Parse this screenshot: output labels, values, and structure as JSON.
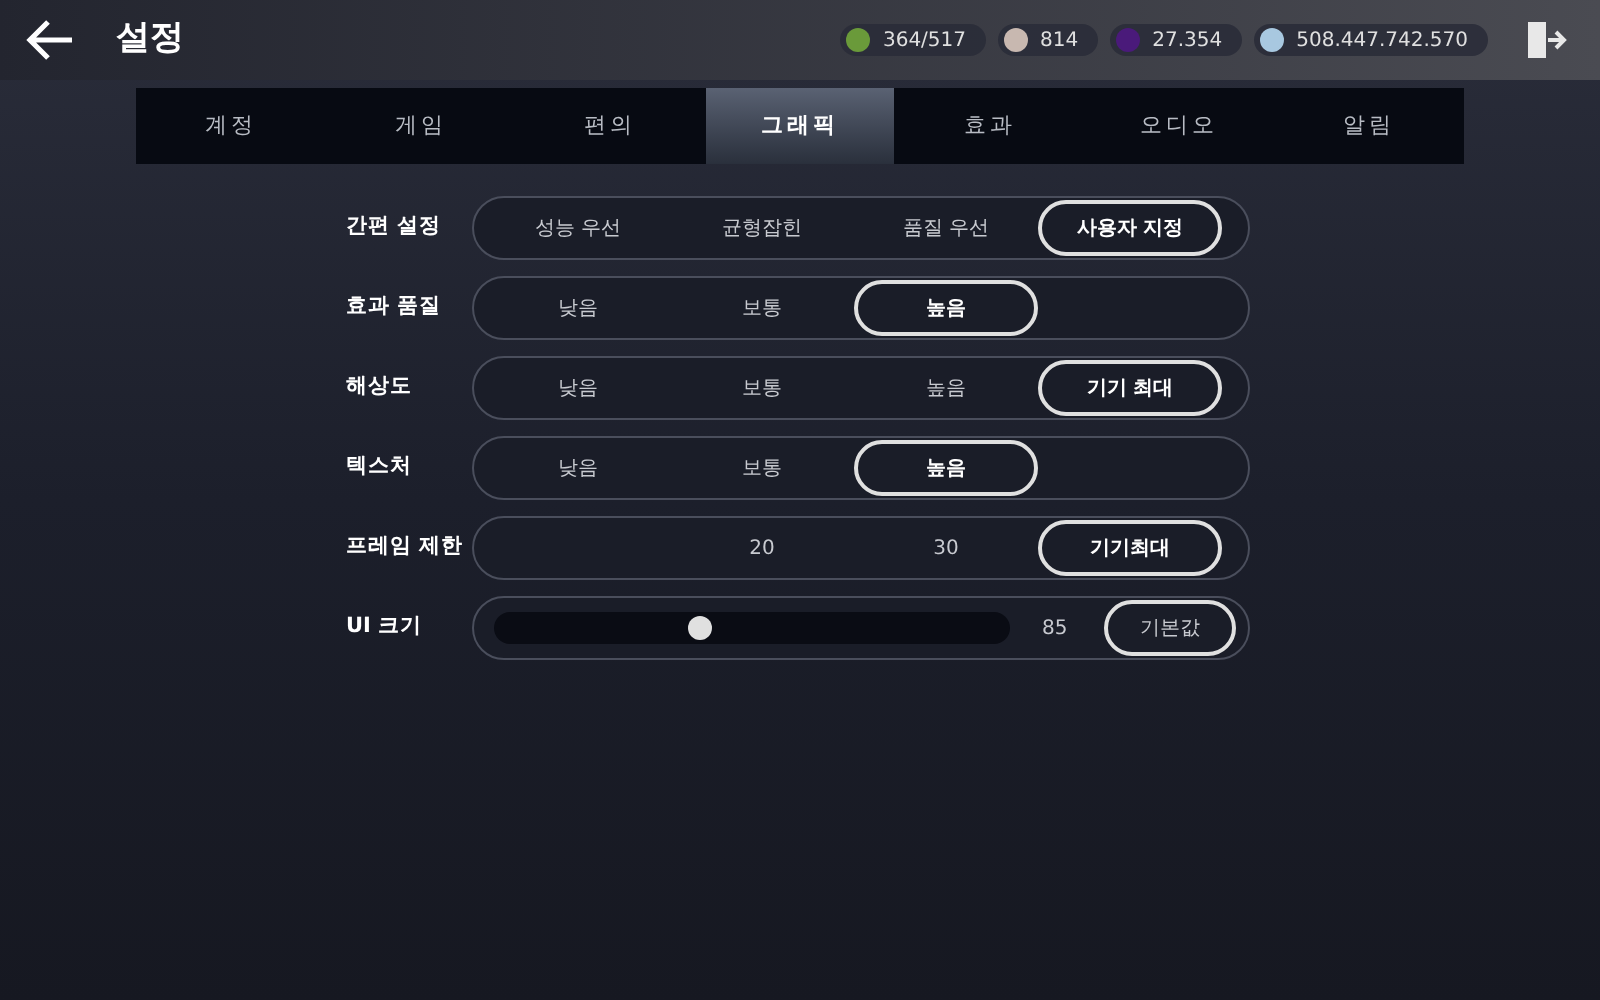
{
  "header": {
    "title": "설정",
    "currencies": [
      {
        "amount": "364/517",
        "color": "#6a9a3a"
      },
      {
        "amount": "814",
        "color": "#c8b8b0"
      },
      {
        "amount": "27.354",
        "color": "#4a1a7a"
      },
      {
        "amount": "508.447.742.570",
        "color": "#a8c8e0"
      }
    ]
  },
  "tabs": [
    {
      "label": "계정",
      "selected": false
    },
    {
      "label": "게임",
      "selected": false
    },
    {
      "label": "편의",
      "selected": false
    },
    {
      "label": "그래픽",
      "selected": true
    },
    {
      "label": "효과",
      "selected": false
    },
    {
      "label": "오디오",
      "selected": false
    },
    {
      "label": "알림",
      "selected": false
    }
  ],
  "settings": [
    {
      "kind": "choice",
      "label": "간편 설정",
      "options": [
        {
          "label": "성능 우선",
          "selected": false
        },
        {
          "label": "균형잡힌",
          "selected": false
        },
        {
          "label": "품질 우선",
          "selected": false
        },
        {
          "label": "사용자 지정",
          "selected": true
        }
      ]
    },
    {
      "kind": "choice",
      "label": "효과 품질",
      "options": [
        {
          "label": "낮음",
          "selected": false
        },
        {
          "label": "보통",
          "selected": false
        },
        {
          "label": "높음",
          "selected": true
        }
      ]
    },
    {
      "kind": "choice",
      "label": "해상도",
      "options": [
        {
          "label": "낮음",
          "selected": false
        },
        {
          "label": "보통",
          "selected": false
        },
        {
          "label": "높음",
          "selected": false
        },
        {
          "label": "기기 최대",
          "selected": true
        }
      ]
    },
    {
      "kind": "choice",
      "label": "텍스처",
      "options": [
        {
          "label": "낮음",
          "selected": false
        },
        {
          "label": "보통",
          "selected": false
        },
        {
          "label": "높음",
          "selected": true
        }
      ]
    },
    {
      "kind": "rightchoice",
      "label": "프레임 제한",
      "options": [
        {
          "label": "20",
          "selected": false
        },
        {
          "label": "30",
          "selected": false
        },
        {
          "label": "기기최대",
          "selected": true
        }
      ]
    },
    {
      "kind": "slider",
      "label": "UI 크기",
      "level": 0.4,
      "reading": "85",
      "button": "기본값"
    }
  ]
}
